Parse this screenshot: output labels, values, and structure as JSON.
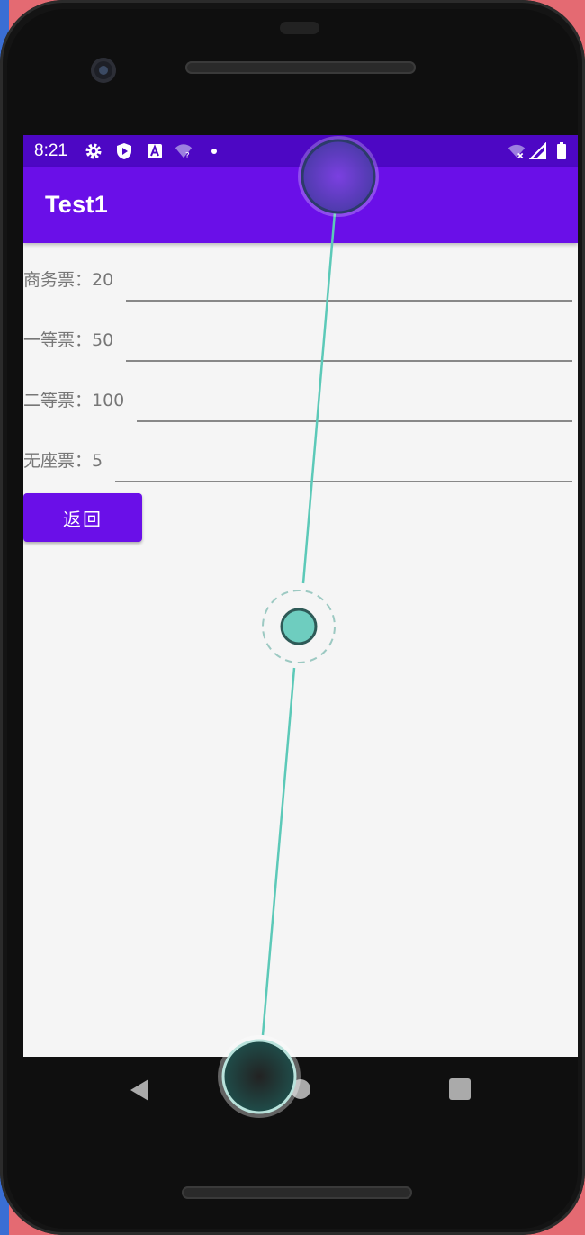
{
  "status_bar": {
    "time": "8:21",
    "left_icons": [
      "gear-icon",
      "shield-play-icon",
      "a-box-icon",
      "wifi-question-icon",
      "dot-icon"
    ],
    "right_icons": [
      "wifi-off-icon",
      "signal-icon",
      "battery-icon"
    ]
  },
  "app_bar": {
    "title": "Test1"
  },
  "fields": [
    {
      "label": "商务票：20"
    },
    {
      "label": "一等票：50"
    },
    {
      "label": "二等票：100"
    },
    {
      "label": "无座票：5"
    }
  ],
  "back_button": {
    "label": "返回"
  },
  "nav_bar": {
    "icons": [
      "back-triangle-icon",
      "home-circle-icon",
      "recent-square-icon"
    ]
  },
  "colors": {
    "primary": "#6a0fe8",
    "status_bar": "#4d07c4",
    "background": "#f5f5f5",
    "gesture_line": "#5cc9b8"
  }
}
